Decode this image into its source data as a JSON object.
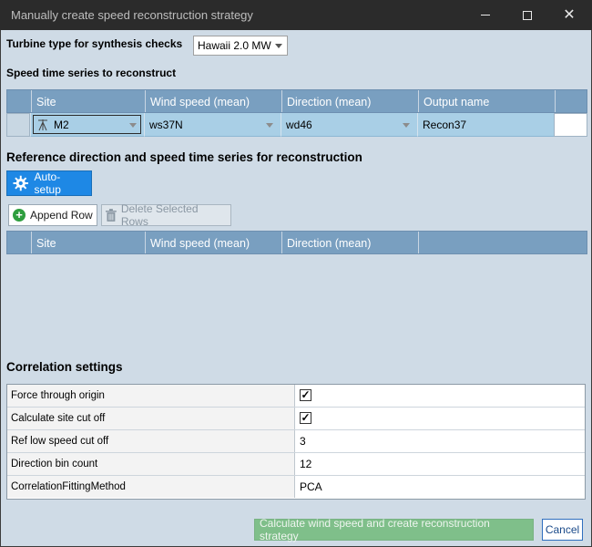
{
  "window": {
    "title": "Manually create speed reconstruction strategy"
  },
  "turbine": {
    "label": "Turbine type for synthesis checks",
    "selected": "Hawaii 2.0 MW"
  },
  "speed_series": {
    "heading": "Speed time series to reconstruct",
    "columns": [
      "Site",
      "Wind speed (mean)",
      "Direction (mean)",
      "Output name"
    ],
    "row": {
      "site": "M2",
      "wind_speed": "ws37N",
      "direction": "wd46",
      "output_name": "Recon37"
    }
  },
  "reference": {
    "heading": "Reference direction and speed time series for reconstruction",
    "auto_setup_label": "Auto-setup",
    "append_row_label": "Append Row",
    "delete_rows_label": "Delete Selected Rows",
    "columns": [
      "Site",
      "Wind speed (mean)",
      "Direction (mean)"
    ]
  },
  "correlation": {
    "heading": "Correlation settings",
    "rows": [
      {
        "key": "Force through origin",
        "value": "✓"
      },
      {
        "key": "Calculate site cut off",
        "value": "✓"
      },
      {
        "key": "Ref low speed cut off",
        "value": "3"
      },
      {
        "key": "Direction bin count",
        "value": "12"
      },
      {
        "key": "CorrelationFittingMethod",
        "value": "PCA"
      }
    ]
  },
  "footer": {
    "calculate_label": "Calculate wind speed and create reconstruction strategy",
    "cancel_label": "Cancel"
  },
  "colors": {
    "header_blue": "#799fc0",
    "selected_row": "#a9cfe6",
    "auto_setup": "#1e88e5",
    "calculate_green": "#7fbf8a"
  }
}
